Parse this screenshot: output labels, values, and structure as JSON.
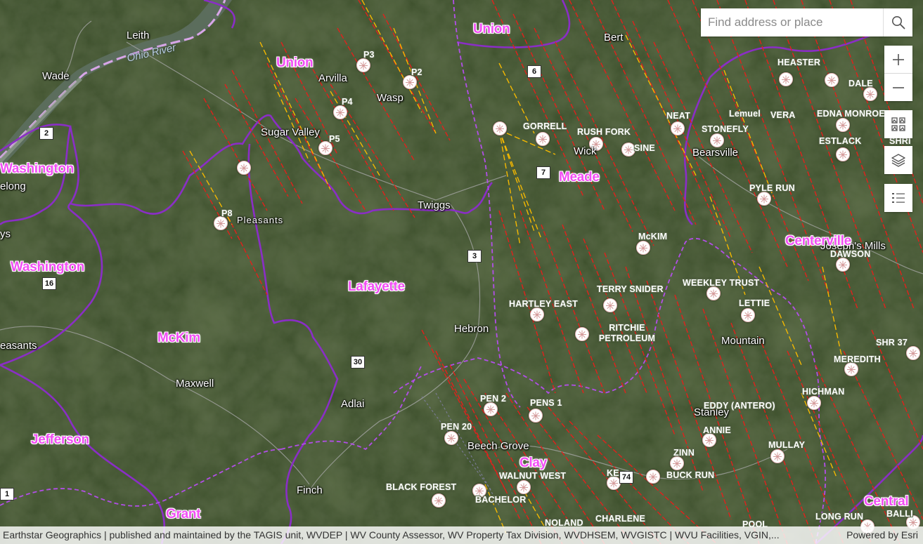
{
  "search": {
    "placeholder": "Find address or place"
  },
  "controls": [
    "zoom-in",
    "zoom-out",
    "basemap-gallery",
    "layer-list",
    "legend"
  ],
  "attribution": {
    "text": "Earthstar Geographics | published and maintained by the TAGIS unit, WVDEP | WV County Assessor, WV Property Tax Division, WVDHSEM, WVGISTC | WVU Facilities, VGIN,...",
    "powered_by": "Powered by Esri"
  },
  "colors": {
    "district_label": "#f24df5",
    "county_boundary": "#8a2ec6",
    "district_boundary": "#b24ee8",
    "permit_line": "#e3201b",
    "permit_line_alt": "#f5b800"
  },
  "places": [
    "Leith",
    "Wade",
    "Arvilla",
    "Wasp",
    "Sugar Valley",
    "Pleasants",
    "Twiggs",
    "Bert",
    "Wick",
    "Bearsville",
    "Joseph's Mills",
    "Hebron",
    "Mountain",
    "Maxwell",
    "Adlai",
    "Beech Grove",
    "Stanley",
    "Finch",
    "elong",
    "ys",
    "easants"
  ],
  "water": [
    "Ohio River"
  ],
  "districts": [
    "Union",
    "Union",
    "Washington",
    "Washington",
    "Meade",
    "Lafayette",
    "McKim",
    "Jefferson",
    "Grant",
    "Clay",
    "Centerville",
    "Central"
  ],
  "routes": [
    "2",
    "6",
    "7",
    "3",
    "16",
    "30",
    "74",
    "1"
  ],
  "fields": [
    "P3",
    "P2",
    "P4",
    "P5",
    "P8",
    "GORRELL",
    "RUSH FORK",
    "SINE",
    "NEAT",
    "STONEFLY",
    "Lemuel",
    "VERA",
    "HEASTER",
    "DALE",
    "EDNA MONROE",
    "ESTLACK",
    "SHRI",
    "PYLE RUN",
    "McKIM",
    "DAWSON",
    "TERRY SNIDER",
    "WEEKLEY TRUST",
    "HARTLEY EAST",
    "LETTIE",
    "RITCHIE PETROLEUM",
    "SHR 37",
    "MEREDITH",
    "HICHMAN",
    "PEN 2",
    "PENS 1",
    "EDDY (ANTERO)",
    "PEN 20",
    "ANNIE",
    "MULLAY",
    "ZINN",
    "KE",
    "BUCK RUN",
    "WALNUT WEST",
    "BLACK FOREST",
    "BACHELOR",
    "NOLAND",
    "CHARLENE",
    "POOL",
    "LONG RUN",
    "BALLI"
  ]
}
